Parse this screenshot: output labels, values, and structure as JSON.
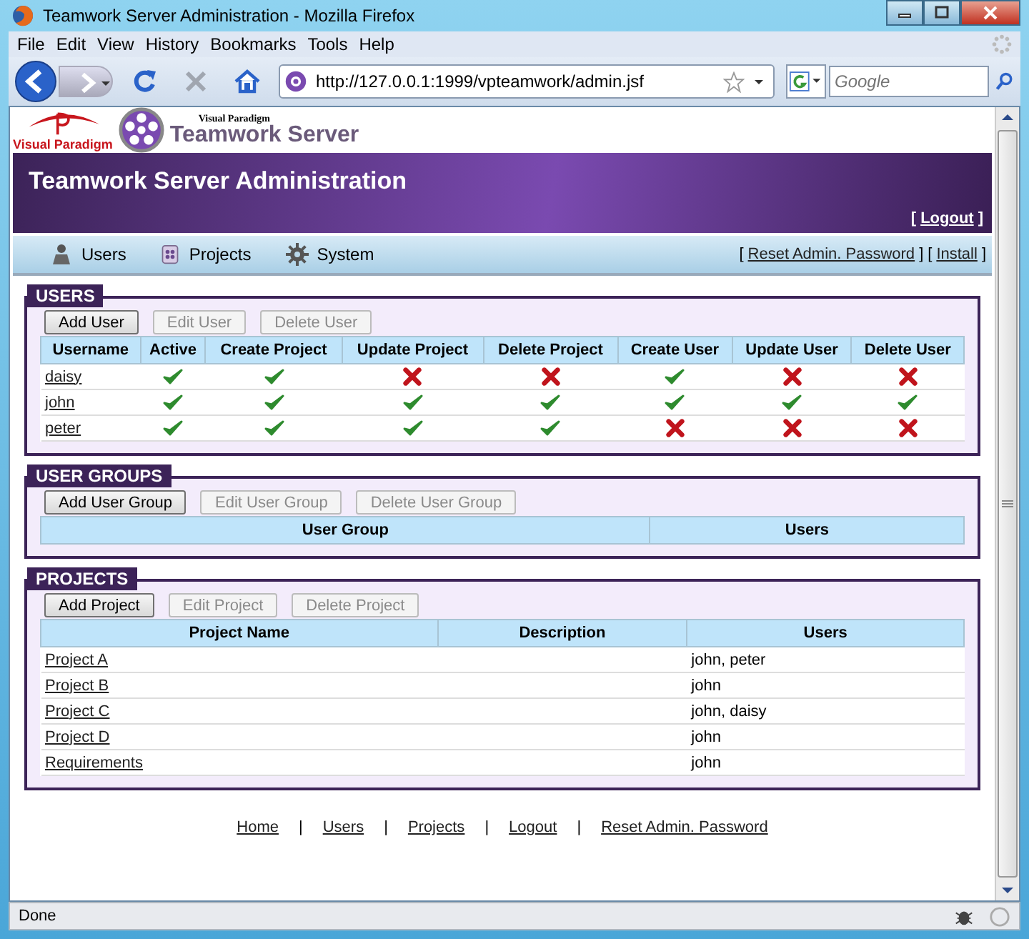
{
  "window": {
    "title": "Teamwork Server Administration - Mozilla Firefox"
  },
  "menu": [
    "File",
    "Edit",
    "View",
    "History",
    "Bookmarks",
    "Tools",
    "Help"
  ],
  "toolbar": {
    "url": "http://127.0.0.1:1999/vpteamwork/admin.jsf",
    "search_placeholder": "Google"
  },
  "logo": {
    "brand": "Visual Paradigm",
    "tagline": "Visual Paradigm",
    "product": "Teamwork Server"
  },
  "banner": {
    "title": "Teamwork Server Administration",
    "links": [
      {
        "open": "[",
        "label": "Logout",
        "close": "]"
      }
    ]
  },
  "nav": {
    "tabs": [
      {
        "label": "Users",
        "kind": "users"
      },
      {
        "label": "Projects",
        "kind": "projects"
      },
      {
        "label": "System",
        "kind": "system"
      }
    ],
    "links": [
      {
        "open": "[",
        "label": "Reset Admin. Password",
        "close": "]"
      },
      {
        "open": "[",
        "label": "Install",
        "close": "]"
      }
    ]
  },
  "users": {
    "title": "USERS",
    "buttons": [
      {
        "label": "Add User",
        "disabled": false
      },
      {
        "label": "Edit User",
        "disabled": true
      },
      {
        "label": "Delete User",
        "disabled": true
      }
    ],
    "columns": [
      "Username",
      "Active",
      "Create Project",
      "Update Project",
      "Delete Project",
      "Create User",
      "Update User",
      "Delete User"
    ],
    "rows": [
      {
        "username": "daisy",
        "permissions": [
          true,
          true,
          false,
          false,
          true,
          false,
          false
        ]
      },
      {
        "username": "john",
        "permissions": [
          true,
          true,
          true,
          true,
          true,
          true,
          true
        ]
      },
      {
        "username": "peter",
        "permissions": [
          true,
          true,
          true,
          true,
          false,
          false,
          false
        ]
      }
    ]
  },
  "user_groups": {
    "title": "USER GROUPS",
    "buttons": [
      {
        "label": "Add User Group",
        "disabled": false
      },
      {
        "label": "Edit User Group",
        "disabled": true
      },
      {
        "label": "Delete User Group",
        "disabled": true
      }
    ],
    "columns": [
      "User Group",
      "Users"
    ]
  },
  "projects": {
    "title": "PROJECTS",
    "buttons": [
      {
        "label": "Add Project",
        "disabled": false
      },
      {
        "label": "Edit Project",
        "disabled": true
      },
      {
        "label": "Delete Project",
        "disabled": true
      }
    ],
    "columns": [
      "Project Name",
      "Description",
      "Users"
    ],
    "rows": [
      {
        "name": "Project A",
        "users": "john, peter"
      },
      {
        "name": "Project B",
        "users": "john"
      },
      {
        "name": "Project C",
        "users": "john, daisy"
      },
      {
        "name": "Project D",
        "users": "john"
      },
      {
        "name": "Requirements",
        "users": "john"
      }
    ]
  },
  "footer": [
    {
      "kind": "link",
      "text": "Home"
    },
    {
      "kind": "separator",
      "text": "|"
    },
    {
      "kind": "link",
      "text": "Users"
    },
    {
      "kind": "separator",
      "text": "|"
    },
    {
      "kind": "link",
      "text": "Projects"
    },
    {
      "kind": "separator",
      "text": "|"
    },
    {
      "kind": "link",
      "text": "Logout"
    },
    {
      "kind": "separator",
      "text": "|"
    },
    {
      "kind": "link",
      "text": "Reset Admin. Password"
    }
  ],
  "status_bar": {
    "text": "Done"
  }
}
